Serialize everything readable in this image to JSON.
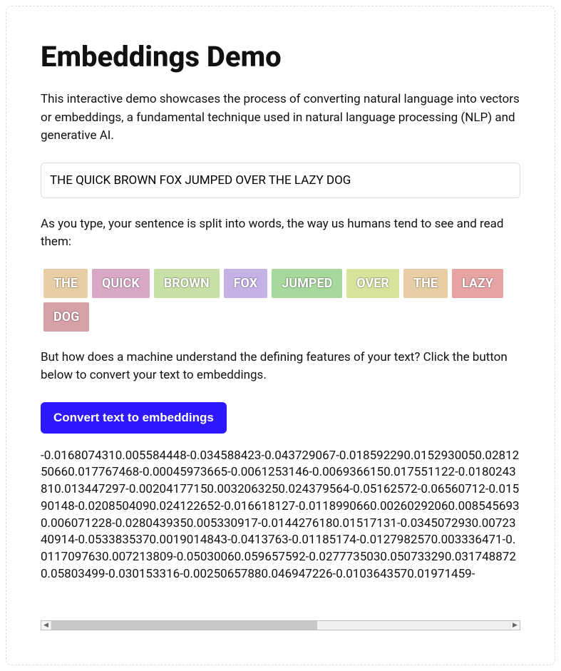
{
  "title": "Embeddings Demo",
  "intro": "This interactive demo showcases the process of converting natural language into vectors or embeddings, a fundamental technique used in natural language processing (NLP) and generative AI.",
  "input_value": "THE QUICK BROWN FOX JUMPED OVER THE LAZY DOG",
  "split_caption": "As you type, your sentence is split into words, the way us humans tend to see and read them:",
  "tokens": [
    {
      "label": "THE",
      "color": "#e6cda4"
    },
    {
      "label": "QUICK",
      "color": "#d9a8c7"
    },
    {
      "label": "BROWN",
      "color": "#c7e0a6"
    },
    {
      "label": "FOX",
      "color": "#c5b1e6"
    },
    {
      "label": "JUMPED",
      "color": "#a5d89a"
    },
    {
      "label": "OVER",
      "color": "#d7e29d"
    },
    {
      "label": "THE",
      "color": "#e6cda4"
    },
    {
      "label": "LAZY",
      "color": "#e6a3a3"
    },
    {
      "label": "DOG",
      "color": "#d6a0a7"
    }
  ],
  "machine_caption": "But how does a machine understand the defining features of your text? Click the button below to convert your text to embeddings.",
  "button_label": "Convert text to embeddings",
  "embedding_output": "-0.0168074310.005584448-0.034588423-0.043729067-0.018592290.0152930050.0281250660.017767468-0.00045973665-0.0061253146-0.0069366150.017551122-0.0180243810.013447297-0.00204177150.0032063250.024379564-0.05162572-0.06560712-0.01590148-0.0208504090.024122652-0.016618127-0.0118990660.00260292060.0085456930.006071228-0.0280439350.005330917-0.0144276180.01517131-0.0345072930.0072340914-0.0533835370.0019014843-0.0413763-0.01185174-0.0127982570.003336471-0.0117097630.007213809-0.05030060.059657592-0.0277735030.050733290.0317488720.05803499-0.030153316-0.00250657880.046947226-0.0103643570.01971459-"
}
